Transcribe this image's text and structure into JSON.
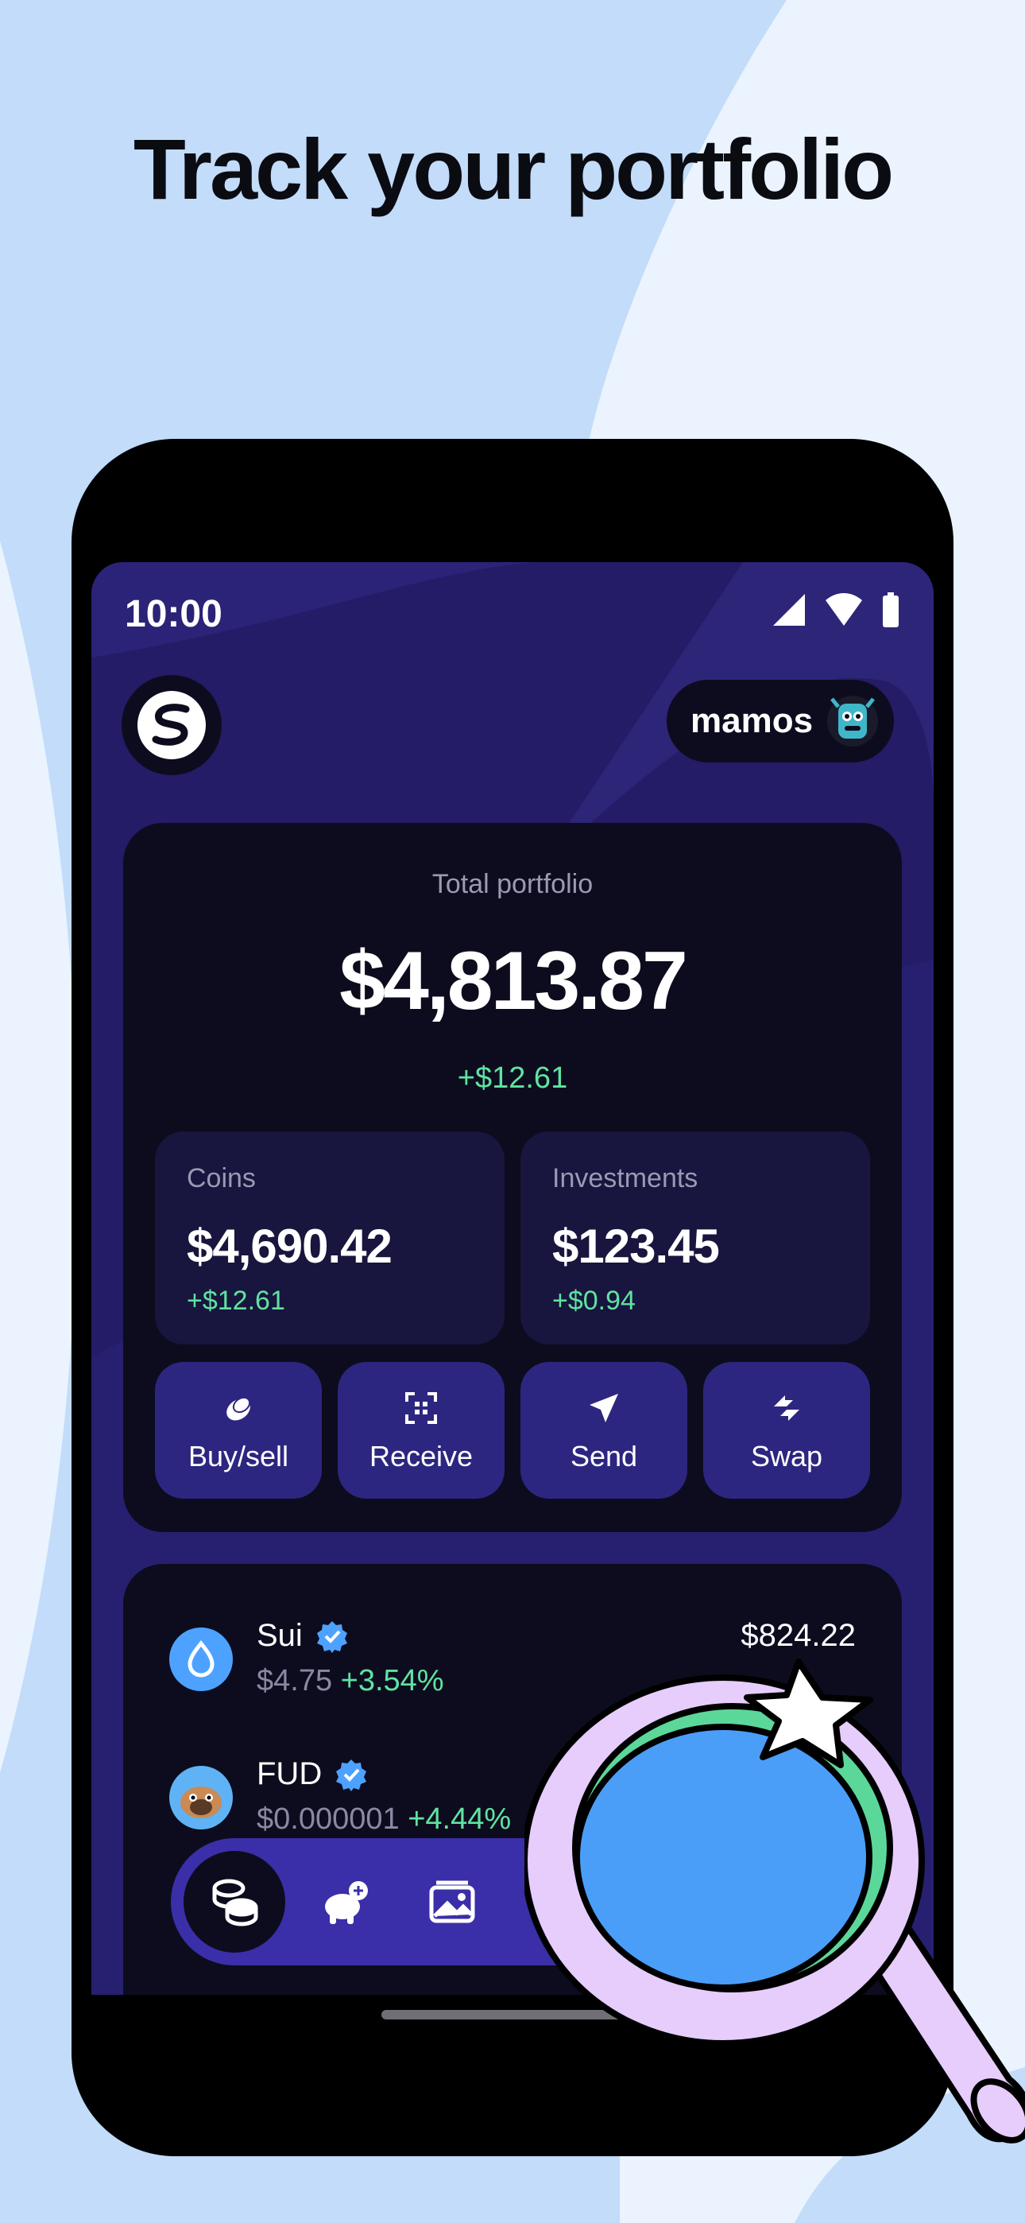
{
  "headline": "Track your portfolio",
  "status_bar": {
    "time": "10:00"
  },
  "header": {
    "username": "mamos"
  },
  "portfolio": {
    "label": "Total portfolio",
    "total": "$4,813.87",
    "change": "+$12.61",
    "coins": {
      "label": "Coins",
      "value": "$4,690.42",
      "change": "+$12.61"
    },
    "investments": {
      "label": "Investments",
      "value": "$123.45",
      "change": "+$0.94"
    }
  },
  "actions": [
    {
      "label": "Buy/sell",
      "icon": "coin-icon"
    },
    {
      "label": "Receive",
      "icon": "qr-code-icon"
    },
    {
      "label": "Send",
      "icon": "paper-plane-icon"
    },
    {
      "label": "Swap",
      "icon": "swap-arrows-icon"
    }
  ],
  "coins": [
    {
      "name": "Sui",
      "verified": true,
      "price": "$4.75",
      "change": "+3.54%",
      "value": "$824.22",
      "icon": "sui-droplet-icon"
    },
    {
      "name": "FUD",
      "verified": true,
      "price": "$0.000001",
      "change": "+4.44%",
      "value": "",
      "icon": "fud-pug-icon"
    }
  ],
  "bottom_nav": [
    "coins-icon",
    "piggy-bank-icon",
    "gallery-icon"
  ],
  "colors": {
    "page_bg": "#eaf3fe",
    "page_accent": "#c2dcfa",
    "screen_bg": "#241c66",
    "card_bg": "#0d0c1e",
    "subcard_bg": "#18153e",
    "action_bg": "#2d2680",
    "positive": "#5fe3a1",
    "muted": "#9b9ab2",
    "magnifier_purple": "#e6cdfb",
    "magnifier_blue": "#4a9ef8",
    "magnifier_green": "#5bd79a"
  }
}
